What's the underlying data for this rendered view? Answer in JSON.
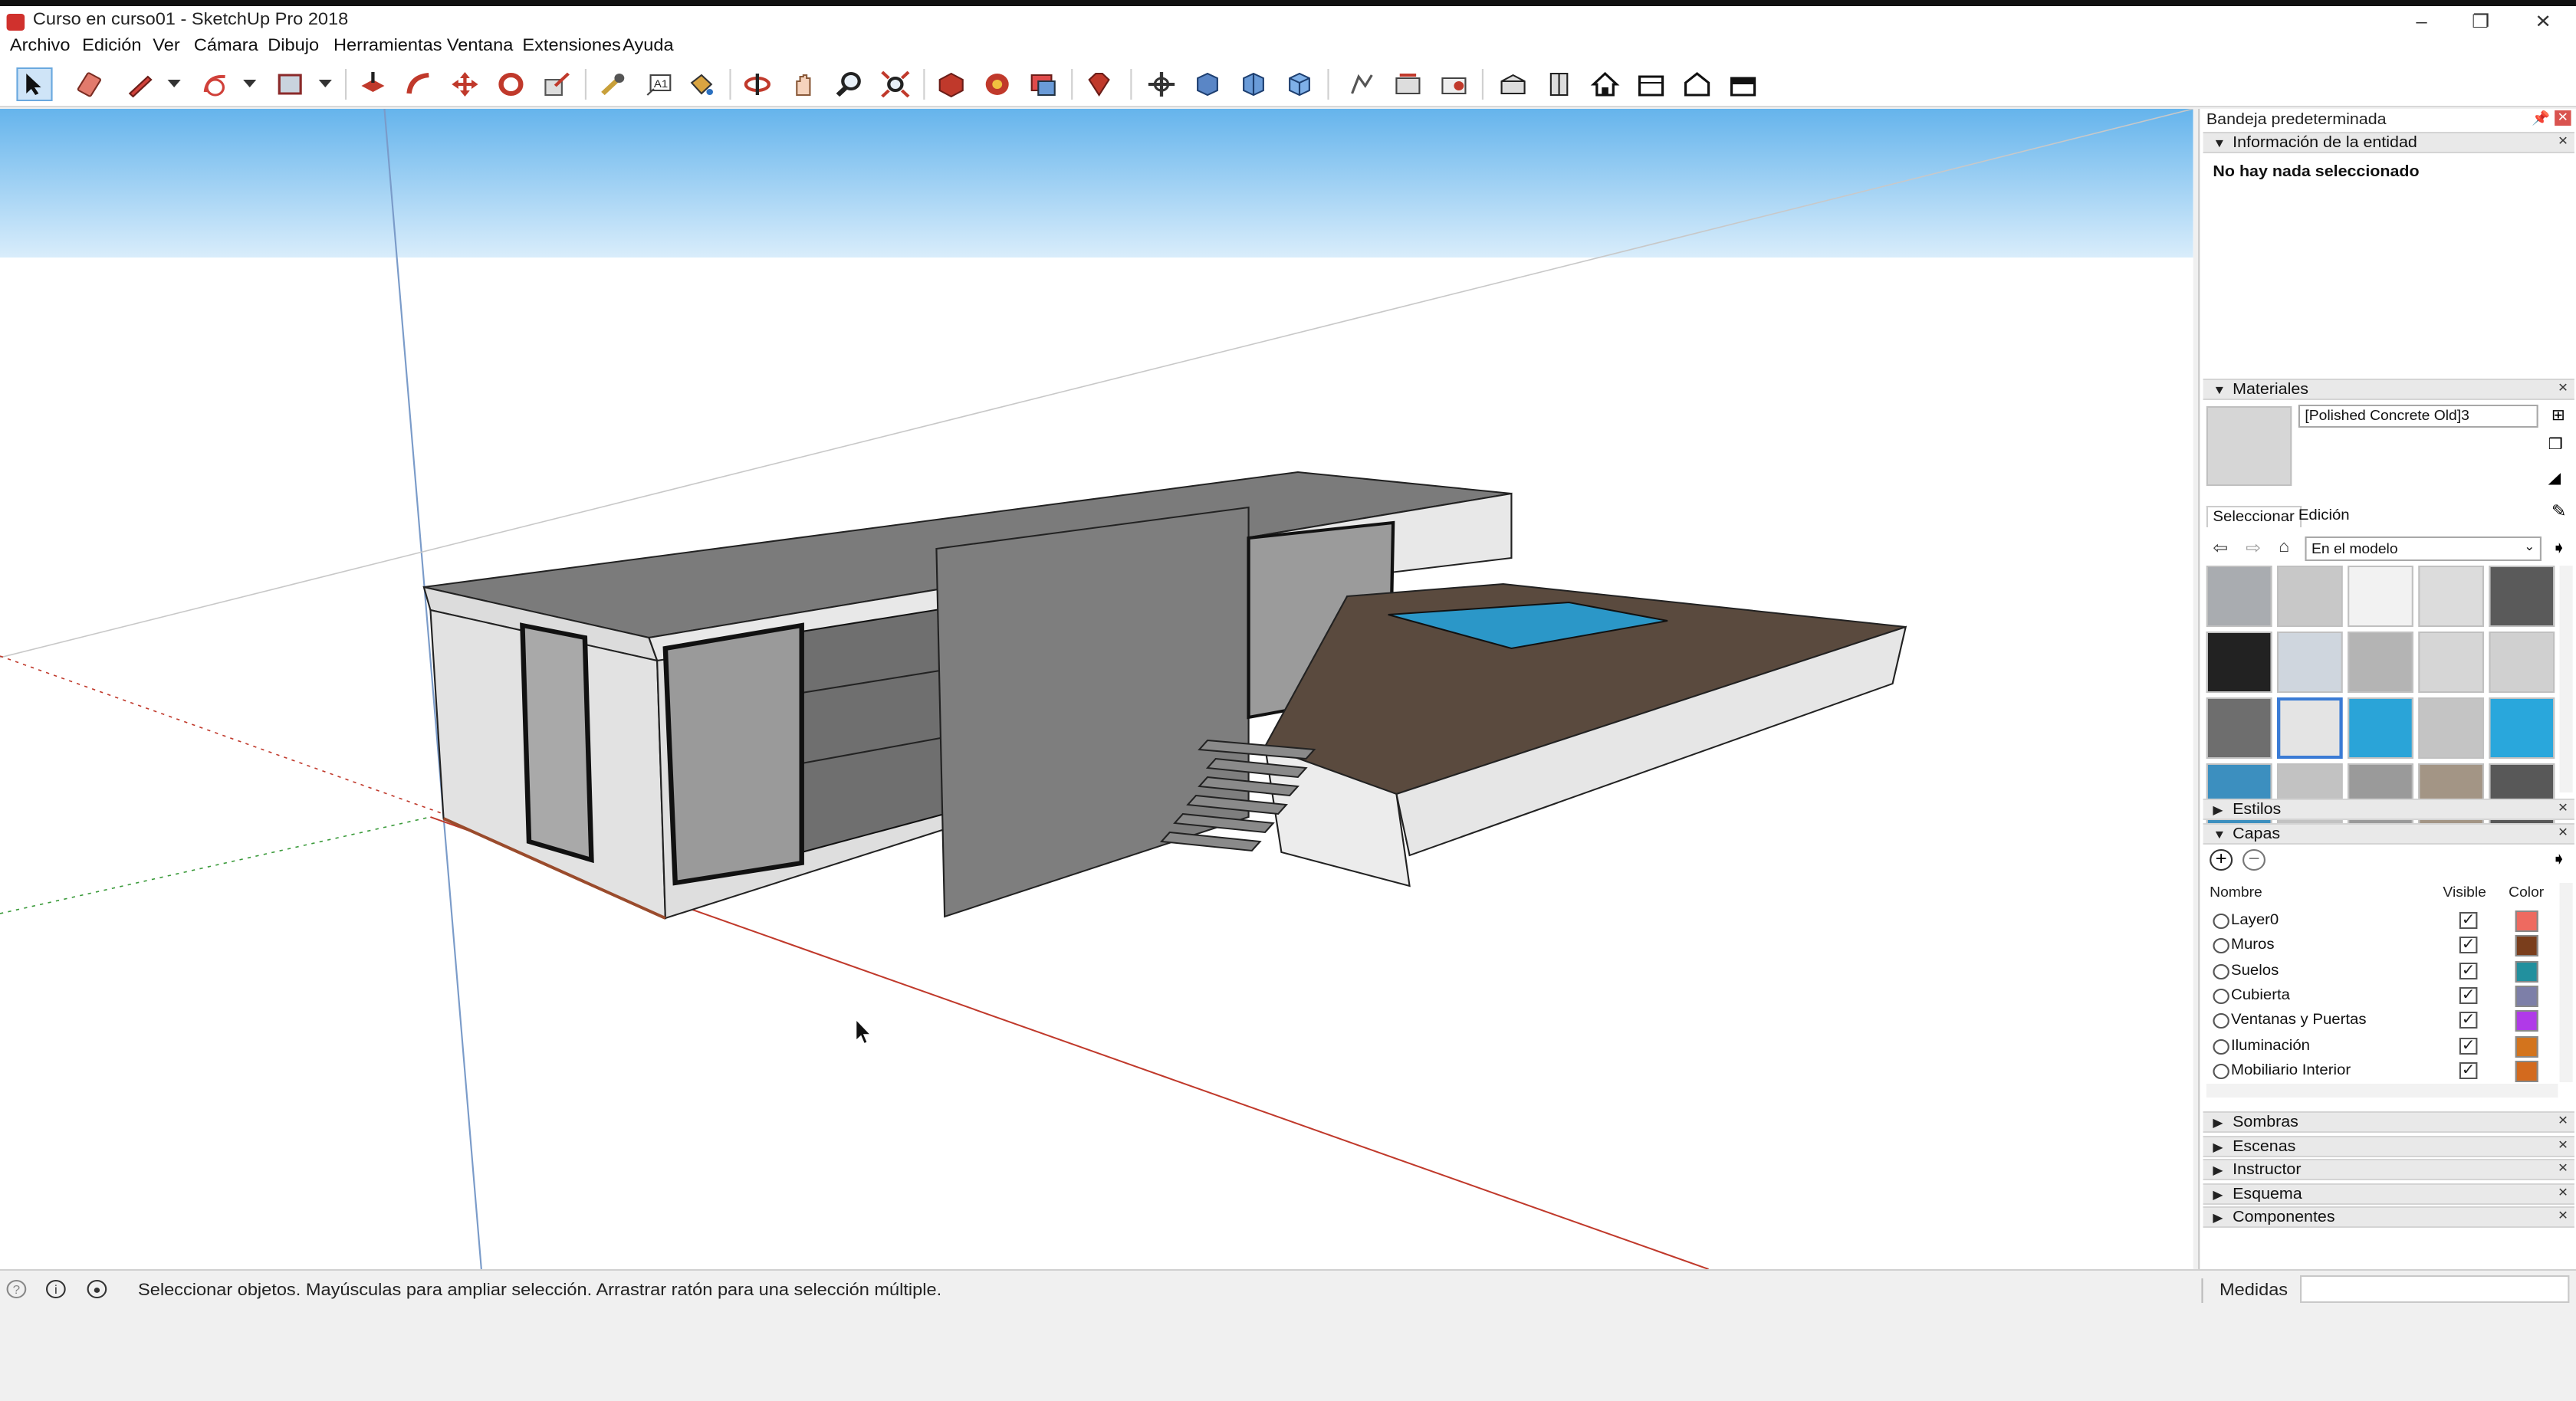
{
  "window": {
    "title": "Curso en curso01 - SketchUp Pro 2018",
    "minimize": "–",
    "restore": "❐",
    "close": "✕"
  },
  "menu": [
    "Archivo",
    "Edición",
    "Ver",
    "Cámara",
    "Dibujo",
    "Herramientas",
    "Ventana",
    "Extensiones",
    "Ayuda"
  ],
  "toolbar": {
    "icons": [
      "select-icon",
      "eraser-icon",
      "pencil-icon",
      "arc-icon",
      "rectangle-icon",
      "push-pull-icon",
      "follow-me-icon",
      "move-icon",
      "rotate-icon",
      "scale-icon",
      "tape-measure-icon",
      "text-icon",
      "paint-bucket-icon",
      "orbit-icon",
      "pan-icon",
      "zoom-icon",
      "zoom-extents-icon",
      "3d-warehouse-icon",
      "extension-warehouse-icon",
      "send-to-layout-icon",
      "ruby-icon",
      "section-plane-icon",
      "display-section-icon",
      "section-cuts-icon",
      "section-fill-icon",
      "walk-icon",
      "position-camera-icon",
      "look-around-icon",
      "iso-view-icon",
      "top-view-icon",
      "front-view-icon",
      "right-view-icon",
      "back-view-icon",
      "left-view-icon"
    ]
  },
  "tray": {
    "title": "Bandeja predeterminada",
    "entity_info": {
      "header": "Información de la entidad",
      "status": "No hay nada seleccionado"
    },
    "materials": {
      "header": "Materiales",
      "name": "[Polished Concrete Old]3",
      "tabs": [
        "Seleccionar",
        "Edición"
      ],
      "collection": "En el modelo",
      "swatches": [
        "#a9acb0",
        "#c8c8c8",
        "#f2f2f2",
        "#dcdcdc",
        "#5a5a5a",
        "#222222",
        "#cfd6de",
        "#b4b4b4",
        "#d6d6d6",
        "#d0d0d0",
        "#6e6e6e",
        "#e4e4e4",
        "#2aa4d8",
        "#c4c4c4",
        "#29a7dc",
        "#3c8fbf",
        "#c2c2c2",
        "#9a9a9a",
        "#a39585",
        "#585858"
      ]
    },
    "styles": {
      "header": "Estilos"
    },
    "layers": {
      "header": "Capas",
      "col_name": "Nombre",
      "col_visible": "Visible",
      "col_color": "Color",
      "items": [
        {
          "name": "Layer0",
          "visible": true,
          "color": "#ee6a60"
        },
        {
          "name": "Muros",
          "visible": true,
          "color": "#7a3e1c"
        },
        {
          "name": "Suelos",
          "visible": true,
          "color": "#22909e"
        },
        {
          "name": "Cubierta",
          "visible": true,
          "color": "#7d7fa8"
        },
        {
          "name": "Ventanas y Puertas",
          "visible": true,
          "color": "#b03ae8"
        },
        {
          "name": "Iluminación",
          "visible": true,
          "color": "#d3741d"
        },
        {
          "name": "Mobiliario Interior",
          "visible": true,
          "color": "#d36a1e"
        }
      ]
    },
    "collapsed": [
      "Sombras",
      "Escenas",
      "Instructor",
      "Esquema",
      "Componentes"
    ]
  },
  "status": {
    "hint": "Seleccionar objetos. Mayúsculas para ampliar selección. Arrastrar ratón para una selección múltiple.",
    "measurements_label": "Medidas",
    "measurements_value": ""
  }
}
